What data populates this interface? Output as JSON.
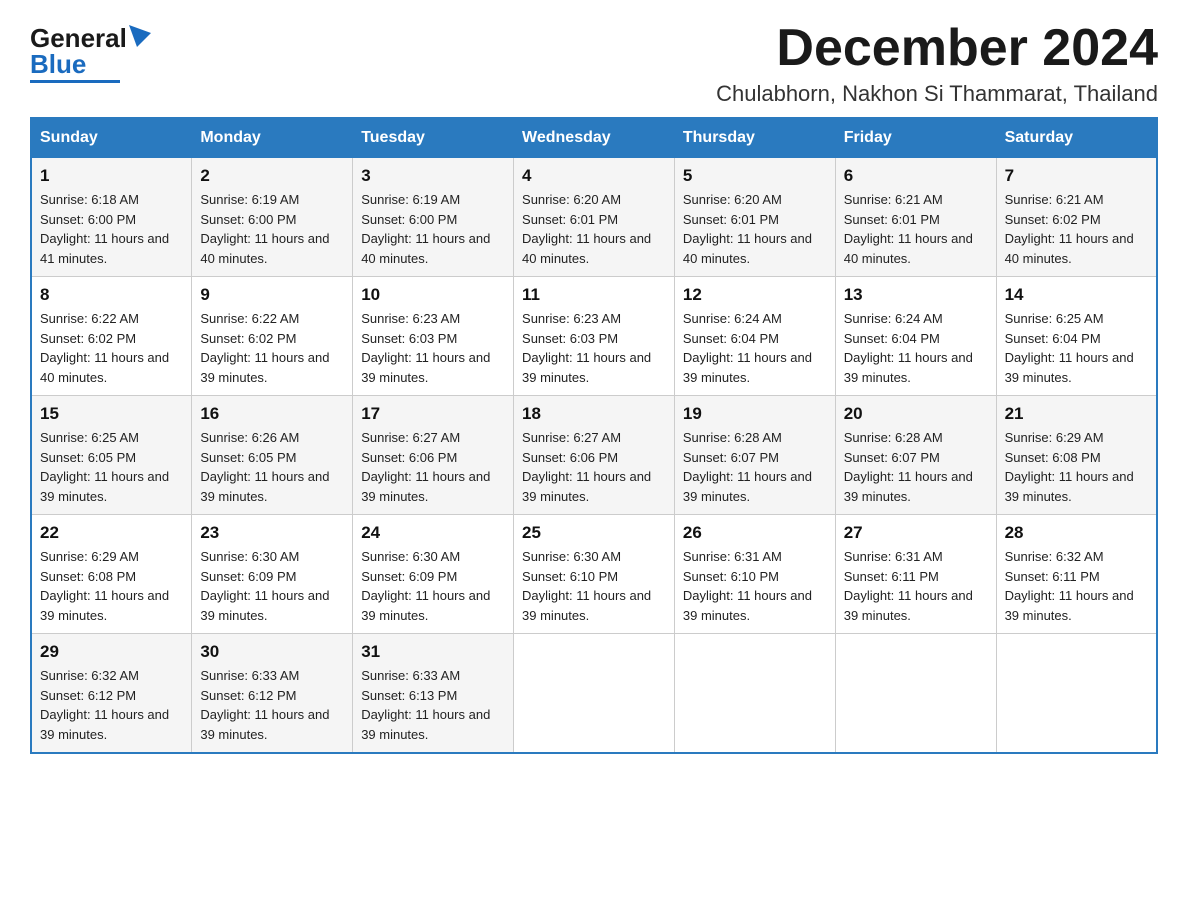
{
  "header": {
    "logo_general": "General",
    "logo_blue": "Blue",
    "month_title": "December 2024",
    "location": "Chulabhorn, Nakhon Si Thammarat, Thailand"
  },
  "weekdays": [
    "Sunday",
    "Monday",
    "Tuesday",
    "Wednesday",
    "Thursday",
    "Friday",
    "Saturday"
  ],
  "weeks": [
    [
      {
        "day": "1",
        "sunrise": "6:18 AM",
        "sunset": "6:00 PM",
        "daylight": "11 hours and 41 minutes."
      },
      {
        "day": "2",
        "sunrise": "6:19 AM",
        "sunset": "6:00 PM",
        "daylight": "11 hours and 40 minutes."
      },
      {
        "day": "3",
        "sunrise": "6:19 AM",
        "sunset": "6:00 PM",
        "daylight": "11 hours and 40 minutes."
      },
      {
        "day": "4",
        "sunrise": "6:20 AM",
        "sunset": "6:01 PM",
        "daylight": "11 hours and 40 minutes."
      },
      {
        "day": "5",
        "sunrise": "6:20 AM",
        "sunset": "6:01 PM",
        "daylight": "11 hours and 40 minutes."
      },
      {
        "day": "6",
        "sunrise": "6:21 AM",
        "sunset": "6:01 PM",
        "daylight": "11 hours and 40 minutes."
      },
      {
        "day": "7",
        "sunrise": "6:21 AM",
        "sunset": "6:02 PM",
        "daylight": "11 hours and 40 minutes."
      }
    ],
    [
      {
        "day": "8",
        "sunrise": "6:22 AM",
        "sunset": "6:02 PM",
        "daylight": "11 hours and 40 minutes."
      },
      {
        "day": "9",
        "sunrise": "6:22 AM",
        "sunset": "6:02 PM",
        "daylight": "11 hours and 39 minutes."
      },
      {
        "day": "10",
        "sunrise": "6:23 AM",
        "sunset": "6:03 PM",
        "daylight": "11 hours and 39 minutes."
      },
      {
        "day": "11",
        "sunrise": "6:23 AM",
        "sunset": "6:03 PM",
        "daylight": "11 hours and 39 minutes."
      },
      {
        "day": "12",
        "sunrise": "6:24 AM",
        "sunset": "6:04 PM",
        "daylight": "11 hours and 39 minutes."
      },
      {
        "day": "13",
        "sunrise": "6:24 AM",
        "sunset": "6:04 PM",
        "daylight": "11 hours and 39 minutes."
      },
      {
        "day": "14",
        "sunrise": "6:25 AM",
        "sunset": "6:04 PM",
        "daylight": "11 hours and 39 minutes."
      }
    ],
    [
      {
        "day": "15",
        "sunrise": "6:25 AM",
        "sunset": "6:05 PM",
        "daylight": "11 hours and 39 minutes."
      },
      {
        "day": "16",
        "sunrise": "6:26 AM",
        "sunset": "6:05 PM",
        "daylight": "11 hours and 39 minutes."
      },
      {
        "day": "17",
        "sunrise": "6:27 AM",
        "sunset": "6:06 PM",
        "daylight": "11 hours and 39 minutes."
      },
      {
        "day": "18",
        "sunrise": "6:27 AM",
        "sunset": "6:06 PM",
        "daylight": "11 hours and 39 minutes."
      },
      {
        "day": "19",
        "sunrise": "6:28 AM",
        "sunset": "6:07 PM",
        "daylight": "11 hours and 39 minutes."
      },
      {
        "day": "20",
        "sunrise": "6:28 AM",
        "sunset": "6:07 PM",
        "daylight": "11 hours and 39 minutes."
      },
      {
        "day": "21",
        "sunrise": "6:29 AM",
        "sunset": "6:08 PM",
        "daylight": "11 hours and 39 minutes."
      }
    ],
    [
      {
        "day": "22",
        "sunrise": "6:29 AM",
        "sunset": "6:08 PM",
        "daylight": "11 hours and 39 minutes."
      },
      {
        "day": "23",
        "sunrise": "6:30 AM",
        "sunset": "6:09 PM",
        "daylight": "11 hours and 39 minutes."
      },
      {
        "day": "24",
        "sunrise": "6:30 AM",
        "sunset": "6:09 PM",
        "daylight": "11 hours and 39 minutes."
      },
      {
        "day": "25",
        "sunrise": "6:30 AM",
        "sunset": "6:10 PM",
        "daylight": "11 hours and 39 minutes."
      },
      {
        "day": "26",
        "sunrise": "6:31 AM",
        "sunset": "6:10 PM",
        "daylight": "11 hours and 39 minutes."
      },
      {
        "day": "27",
        "sunrise": "6:31 AM",
        "sunset": "6:11 PM",
        "daylight": "11 hours and 39 minutes."
      },
      {
        "day": "28",
        "sunrise": "6:32 AM",
        "sunset": "6:11 PM",
        "daylight": "11 hours and 39 minutes."
      }
    ],
    [
      {
        "day": "29",
        "sunrise": "6:32 AM",
        "sunset": "6:12 PM",
        "daylight": "11 hours and 39 minutes."
      },
      {
        "day": "30",
        "sunrise": "6:33 AM",
        "sunset": "6:12 PM",
        "daylight": "11 hours and 39 minutes."
      },
      {
        "day": "31",
        "sunrise": "6:33 AM",
        "sunset": "6:13 PM",
        "daylight": "11 hours and 39 minutes."
      },
      null,
      null,
      null,
      null
    ]
  ]
}
